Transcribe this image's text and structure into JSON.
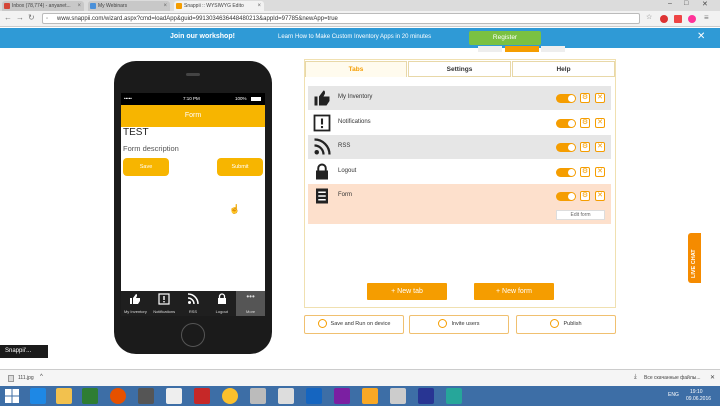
{
  "browser": {
    "tabs": [
      {
        "label": "Inbox (78,774) - anyanet...",
        "color": "#d44638"
      },
      {
        "label": "My Webinars",
        "color": "#4a90d9"
      },
      {
        "label": "Snappii :: WYSIWYG Edito",
        "color": "#f59d00"
      }
    ],
    "url": "www.snappii.com/wizard.aspx?cmd=loadApp&guid=9913034636448480213&appId=97785&newApp=true"
  },
  "promo": {
    "title": "Join our workshop!",
    "text": "Learn How to Make Custom Inventory Apps in 20 minutes",
    "register": "Register"
  },
  "phone": {
    "time": "7:10 PM",
    "battery": "100%",
    "header": "Form",
    "form_title": "TEST",
    "form_description": "Form description",
    "buttons": [
      "Save",
      "Submit"
    ],
    "tabs": [
      {
        "label": "My Inventory",
        "icon": "thumbs-up-icon"
      },
      {
        "label": "Notifications",
        "icon": "exclamation-icon"
      },
      {
        "label": "RSS",
        "icon": "rss-icon"
      },
      {
        "label": "Logout",
        "icon": "lock-icon"
      },
      {
        "label": "More",
        "icon": "more-icon"
      }
    ]
  },
  "panel": {
    "tabs": [
      "Tabs",
      "Settings",
      "Help"
    ],
    "rows": [
      {
        "label": "My Inventory",
        "icon": "thumbs-up-icon"
      },
      {
        "label": "Notifications",
        "icon": "exclamation-icon"
      },
      {
        "label": "RSS",
        "icon": "rss-icon"
      },
      {
        "label": "Logout",
        "icon": "lock-icon"
      },
      {
        "label": "Form",
        "icon": "form-icon"
      }
    ],
    "edit_form": "Edit form",
    "new_tab": "+ New tab",
    "new_form": "+ New form",
    "save": "Save and Run on device",
    "invite": "Invite users",
    "publish": "Publish"
  },
  "live_chat": "LIVE CHAT",
  "snappii_tip": "Snappii'...",
  "download": {
    "file": "111.jpg",
    "show_all": "Все скачанные файлы..."
  },
  "taskbar": {
    "lang": "ENG",
    "time": "19:10",
    "date": "09.06.2016"
  },
  "colors": {
    "accent": "#f59d00",
    "phone_header": "#f7b500",
    "banner": "#2f9ad6"
  }
}
